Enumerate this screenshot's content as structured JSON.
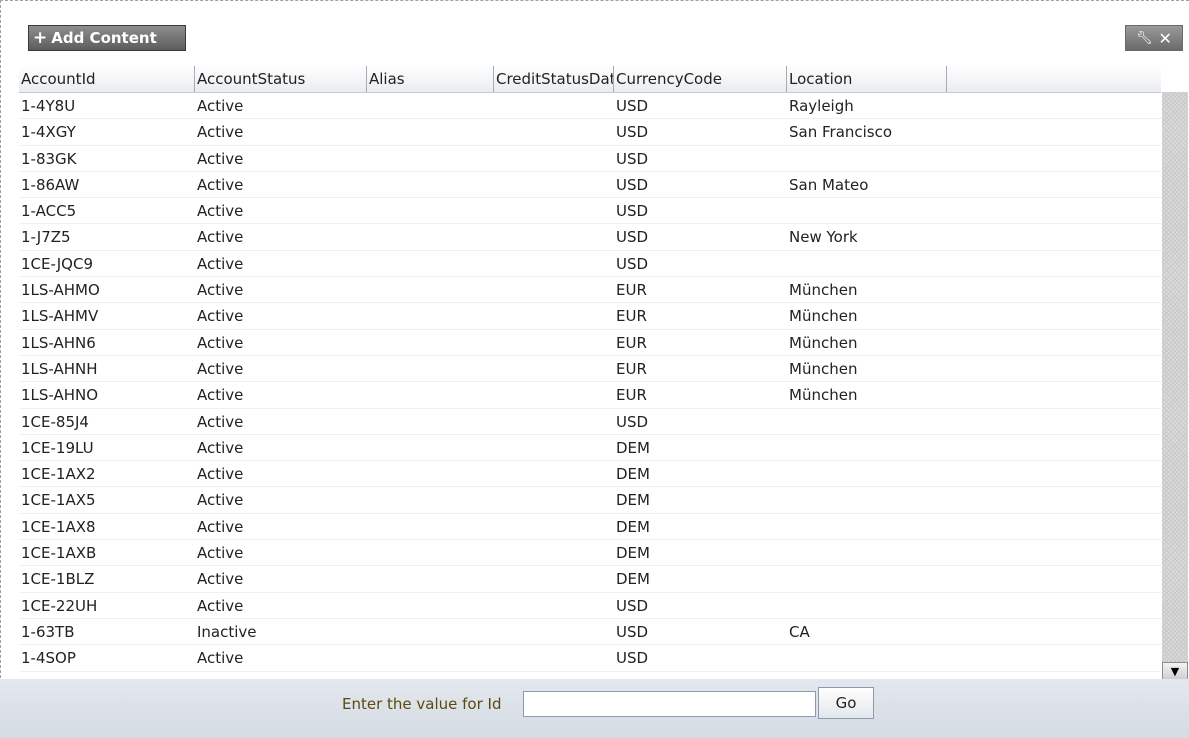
{
  "toolbar": {
    "add_content_label": "Add Content",
    "add_content_icon": "plus-icon",
    "tools_icon": "wrench-icon",
    "close_icon": "close-icon"
  },
  "table": {
    "columns": [
      "AccountId",
      "AccountStatus",
      "Alias",
      "CreditStatusDate",
      "CurrencyCode",
      "Location",
      ""
    ],
    "rows": [
      [
        "1-4Y8U",
        "Active",
        "",
        "",
        "USD",
        "Rayleigh",
        ""
      ],
      [
        "1-4XGY",
        "Active",
        "",
        "",
        "USD",
        "San Francisco",
        ""
      ],
      [
        "1-83GK",
        "Active",
        "",
        "",
        "USD",
        "",
        ""
      ],
      [
        "1-86AW",
        "Active",
        "",
        "",
        "USD",
        "San Mateo",
        ""
      ],
      [
        "1-ACC5",
        "Active",
        "",
        "",
        "USD",
        "",
        ""
      ],
      [
        "1-J7Z5",
        "Active",
        "",
        "",
        "USD",
        "New York",
        ""
      ],
      [
        "1CE-JQC9",
        "Active",
        "",
        "",
        "USD",
        "",
        ""
      ],
      [
        "1LS-AHMO",
        "Active",
        "",
        "",
        "EUR",
        "München",
        ""
      ],
      [
        "1LS-AHMV",
        "Active",
        "",
        "",
        "EUR",
        "München",
        ""
      ],
      [
        "1LS-AHN6",
        "Active",
        "",
        "",
        "EUR",
        "München",
        ""
      ],
      [
        "1LS-AHNH",
        "Active",
        "",
        "",
        "EUR",
        "München",
        ""
      ],
      [
        "1LS-AHNO",
        "Active",
        "",
        "",
        "EUR",
        "München",
        ""
      ],
      [
        "1CE-85J4",
        "Active",
        "",
        "",
        "USD",
        "",
        ""
      ],
      [
        "1CE-19LU",
        "Active",
        "",
        "",
        "DEM",
        "",
        ""
      ],
      [
        "1CE-1AX2",
        "Active",
        "",
        "",
        "DEM",
        "",
        ""
      ],
      [
        "1CE-1AX5",
        "Active",
        "",
        "",
        "DEM",
        "",
        ""
      ],
      [
        "1CE-1AX8",
        "Active",
        "",
        "",
        "DEM",
        "",
        ""
      ],
      [
        "1CE-1AXB",
        "Active",
        "",
        "",
        "DEM",
        "",
        ""
      ],
      [
        "1CE-1BLZ",
        "Active",
        "",
        "",
        "DEM",
        "",
        ""
      ],
      [
        "1CE-22UH",
        "Active",
        "",
        "",
        "USD",
        "",
        ""
      ],
      [
        "1-63TB",
        "Inactive",
        "",
        "",
        "USD",
        "CA",
        ""
      ],
      [
        "1-4SOP",
        "Active",
        "",
        "",
        "USD",
        "",
        ""
      ]
    ]
  },
  "scrollbar": {
    "down_arrow_icon": "arrow-down-icon"
  },
  "footer": {
    "prompt_label": "Enter the value for Id",
    "id_value": "",
    "go_label": "Go"
  }
}
